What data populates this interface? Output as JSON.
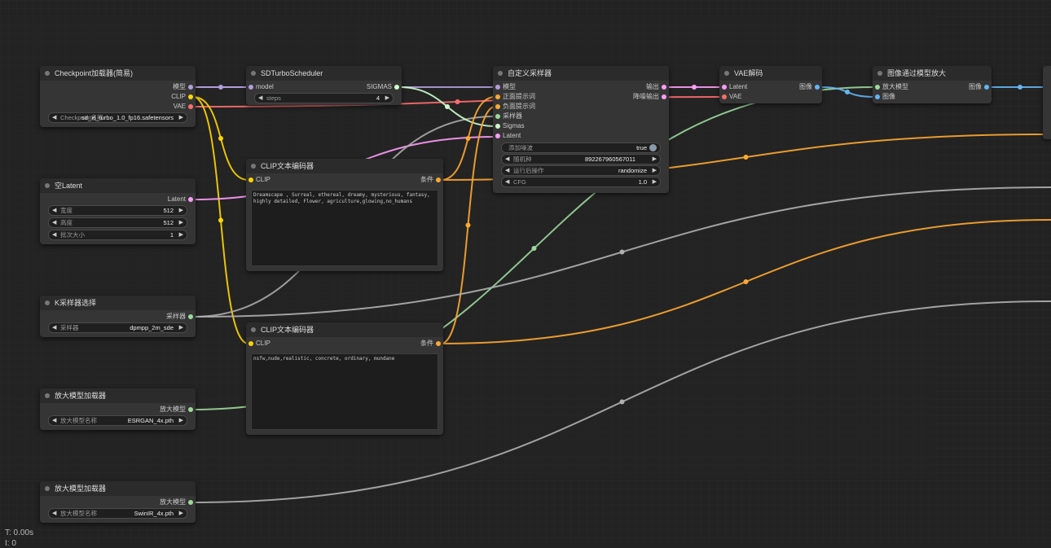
{
  "colors": {
    "model": "#b39ddb",
    "clip": "#ffd500",
    "vae": "#ff6e6e",
    "conditioning": "#ffa931",
    "latent": "#ff9cf9",
    "sampler": "#aaaaaa",
    "sigmas": "#cdffcd",
    "image": "#64b5f6",
    "upscale_model": "#9bd99b",
    "noise": "#b0b0b0"
  },
  "nodes": {
    "checkpoint": {
      "title": "Checkpoint加载器(简易)",
      "outputs": [
        "模型",
        "CLIP",
        "VAE"
      ],
      "widget_label": "Checkpoint名称",
      "widget_value": "sd_xl_turbo_1.0_fp16.safetensors"
    },
    "empty_latent": {
      "title": "空Latent",
      "output": "Latent",
      "widgets": [
        {
          "label": "宽度",
          "value": "512"
        },
        {
          "label": "高度",
          "value": "512"
        },
        {
          "label": "批次大小",
          "value": "1"
        }
      ]
    },
    "ksampler_select": {
      "title": "K采样器选择",
      "output": "采样器",
      "widget_label": "采样器",
      "widget_value": "dpmpp_2m_sde"
    },
    "upscale_loader_1": {
      "title": "放大模型加载器",
      "output": "放大模型",
      "widget_label": "放大模型名称",
      "widget_value": "ESRGAN_4x.pth"
    },
    "upscale_loader_2": {
      "title": "放大模型加载器",
      "output": "放大模型",
      "widget_label": "放大模型名称",
      "widget_value": "SwinIR_4x.pth"
    },
    "sdturbo": {
      "title": "SDTurboScheduler",
      "input": "model",
      "output": "SIGMAS",
      "widget_label": "steps",
      "widget_value": "4"
    },
    "clip_pos": {
      "title": "CLIP文本编码器",
      "input": "CLIP",
      "output": "条件",
      "text": "Dreamscape , Surreal, ethereal, dreamy, mysterious, fantasy, highly detailed, Flower, agriculture,glowing,no_humans"
    },
    "clip_neg": {
      "title": "CLIP文本编码器",
      "input": "CLIP",
      "output": "条件",
      "text": "nsfw,nude,realistic, concrete, ordinary, mundane"
    },
    "custom_sampler": {
      "title": "自定义采样器",
      "inputs": [
        "模型",
        "正面提示词",
        "负面提示词",
        "采样器",
        "Sigmas",
        "Latent"
      ],
      "outputs": [
        "输出",
        "降噪输出"
      ],
      "widgets": [
        {
          "label": "添加噪波",
          "value": "true"
        },
        {
          "label": "随机种",
          "value": "892267960567011"
        },
        {
          "label": "运行后操作",
          "value": "randomize"
        },
        {
          "label": "CFG",
          "value": "1.0"
        }
      ]
    },
    "vae_decode": {
      "title": "VAE解码",
      "inputs": [
        "Latent",
        "VAE"
      ],
      "output": "图像"
    },
    "upscale_image": {
      "title": "图像通过模型放大",
      "inputs": [
        "放大模型",
        "图像"
      ],
      "output": "图像"
    }
  },
  "status": {
    "time": "T: 0.00s",
    "second_line": "I: 0"
  }
}
